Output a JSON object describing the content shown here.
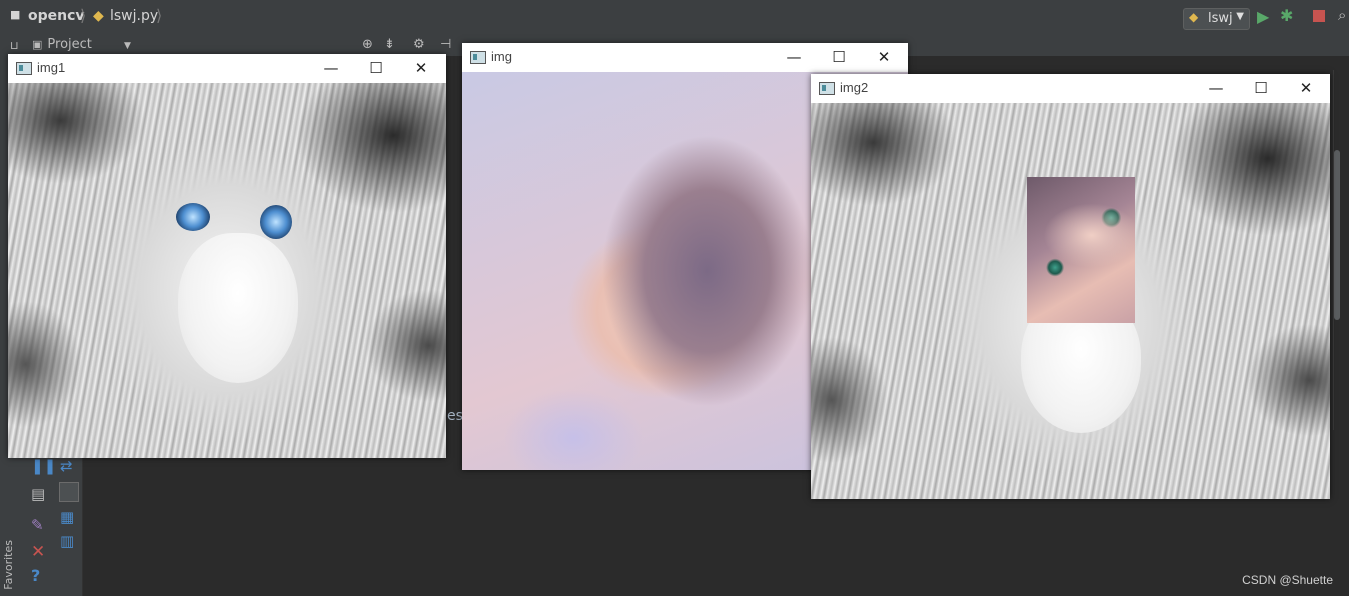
{
  "ide": {
    "project_name": "opencv",
    "file_name": "lswj.py",
    "run_config": "lswj",
    "project_panel_label": "Project",
    "favorites_label": "Favorites",
    "console_fragment": "esl"
  },
  "windows": {
    "img1": {
      "title": "img1"
    },
    "img": {
      "title": "img"
    },
    "img2": {
      "title": "img2"
    }
  },
  "window_controls": {
    "minimize": "—",
    "maximize": "☐",
    "close": "✕"
  },
  "watermark": "CSDN @Shuette",
  "colors": {
    "ide_bg": "#2b2b2b",
    "ide_panel": "#3c3f41",
    "run_green": "#59a869",
    "stop_red": "#c75450"
  }
}
